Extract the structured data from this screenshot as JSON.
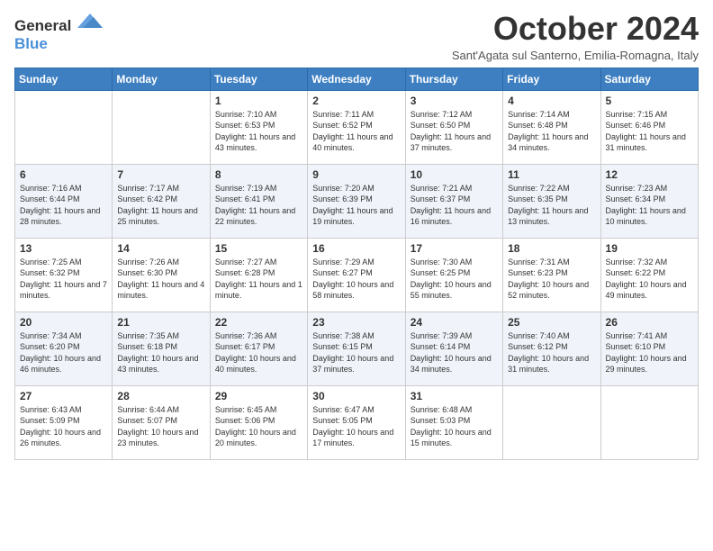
{
  "logo": {
    "general": "General",
    "blue": "Blue"
  },
  "header": {
    "month": "October 2024",
    "subtitle": "Sant'Agata sul Santerno, Emilia-Romagna, Italy"
  },
  "days_of_week": [
    "Sunday",
    "Monday",
    "Tuesday",
    "Wednesday",
    "Thursday",
    "Friday",
    "Saturday"
  ],
  "weeks": [
    [
      {
        "day": "",
        "sunrise": "",
        "sunset": "",
        "daylight": ""
      },
      {
        "day": "",
        "sunrise": "",
        "sunset": "",
        "daylight": ""
      },
      {
        "day": "1",
        "sunrise": "Sunrise: 7:10 AM",
        "sunset": "Sunset: 6:53 PM",
        "daylight": "Daylight: 11 hours and 43 minutes."
      },
      {
        "day": "2",
        "sunrise": "Sunrise: 7:11 AM",
        "sunset": "Sunset: 6:52 PM",
        "daylight": "Daylight: 11 hours and 40 minutes."
      },
      {
        "day": "3",
        "sunrise": "Sunrise: 7:12 AM",
        "sunset": "Sunset: 6:50 PM",
        "daylight": "Daylight: 11 hours and 37 minutes."
      },
      {
        "day": "4",
        "sunrise": "Sunrise: 7:14 AM",
        "sunset": "Sunset: 6:48 PM",
        "daylight": "Daylight: 11 hours and 34 minutes."
      },
      {
        "day": "5",
        "sunrise": "Sunrise: 7:15 AM",
        "sunset": "Sunset: 6:46 PM",
        "daylight": "Daylight: 11 hours and 31 minutes."
      }
    ],
    [
      {
        "day": "6",
        "sunrise": "Sunrise: 7:16 AM",
        "sunset": "Sunset: 6:44 PM",
        "daylight": "Daylight: 11 hours and 28 minutes."
      },
      {
        "day": "7",
        "sunrise": "Sunrise: 7:17 AM",
        "sunset": "Sunset: 6:42 PM",
        "daylight": "Daylight: 11 hours and 25 minutes."
      },
      {
        "day": "8",
        "sunrise": "Sunrise: 7:19 AM",
        "sunset": "Sunset: 6:41 PM",
        "daylight": "Daylight: 11 hours and 22 minutes."
      },
      {
        "day": "9",
        "sunrise": "Sunrise: 7:20 AM",
        "sunset": "Sunset: 6:39 PM",
        "daylight": "Daylight: 11 hours and 19 minutes."
      },
      {
        "day": "10",
        "sunrise": "Sunrise: 7:21 AM",
        "sunset": "Sunset: 6:37 PM",
        "daylight": "Daylight: 11 hours and 16 minutes."
      },
      {
        "day": "11",
        "sunrise": "Sunrise: 7:22 AM",
        "sunset": "Sunset: 6:35 PM",
        "daylight": "Daylight: 11 hours and 13 minutes."
      },
      {
        "day": "12",
        "sunrise": "Sunrise: 7:23 AM",
        "sunset": "Sunset: 6:34 PM",
        "daylight": "Daylight: 11 hours and 10 minutes."
      }
    ],
    [
      {
        "day": "13",
        "sunrise": "Sunrise: 7:25 AM",
        "sunset": "Sunset: 6:32 PM",
        "daylight": "Daylight: 11 hours and 7 minutes."
      },
      {
        "day": "14",
        "sunrise": "Sunrise: 7:26 AM",
        "sunset": "Sunset: 6:30 PM",
        "daylight": "Daylight: 11 hours and 4 minutes."
      },
      {
        "day": "15",
        "sunrise": "Sunrise: 7:27 AM",
        "sunset": "Sunset: 6:28 PM",
        "daylight": "Daylight: 11 hours and 1 minute."
      },
      {
        "day": "16",
        "sunrise": "Sunrise: 7:29 AM",
        "sunset": "Sunset: 6:27 PM",
        "daylight": "Daylight: 10 hours and 58 minutes."
      },
      {
        "day": "17",
        "sunrise": "Sunrise: 7:30 AM",
        "sunset": "Sunset: 6:25 PM",
        "daylight": "Daylight: 10 hours and 55 minutes."
      },
      {
        "day": "18",
        "sunrise": "Sunrise: 7:31 AM",
        "sunset": "Sunset: 6:23 PM",
        "daylight": "Daylight: 10 hours and 52 minutes."
      },
      {
        "day": "19",
        "sunrise": "Sunrise: 7:32 AM",
        "sunset": "Sunset: 6:22 PM",
        "daylight": "Daylight: 10 hours and 49 minutes."
      }
    ],
    [
      {
        "day": "20",
        "sunrise": "Sunrise: 7:34 AM",
        "sunset": "Sunset: 6:20 PM",
        "daylight": "Daylight: 10 hours and 46 minutes."
      },
      {
        "day": "21",
        "sunrise": "Sunrise: 7:35 AM",
        "sunset": "Sunset: 6:18 PM",
        "daylight": "Daylight: 10 hours and 43 minutes."
      },
      {
        "day": "22",
        "sunrise": "Sunrise: 7:36 AM",
        "sunset": "Sunset: 6:17 PM",
        "daylight": "Daylight: 10 hours and 40 minutes."
      },
      {
        "day": "23",
        "sunrise": "Sunrise: 7:38 AM",
        "sunset": "Sunset: 6:15 PM",
        "daylight": "Daylight: 10 hours and 37 minutes."
      },
      {
        "day": "24",
        "sunrise": "Sunrise: 7:39 AM",
        "sunset": "Sunset: 6:14 PM",
        "daylight": "Daylight: 10 hours and 34 minutes."
      },
      {
        "day": "25",
        "sunrise": "Sunrise: 7:40 AM",
        "sunset": "Sunset: 6:12 PM",
        "daylight": "Daylight: 10 hours and 31 minutes."
      },
      {
        "day": "26",
        "sunrise": "Sunrise: 7:41 AM",
        "sunset": "Sunset: 6:10 PM",
        "daylight": "Daylight: 10 hours and 29 minutes."
      }
    ],
    [
      {
        "day": "27",
        "sunrise": "Sunrise: 6:43 AM",
        "sunset": "Sunset: 5:09 PM",
        "daylight": "Daylight: 10 hours and 26 minutes."
      },
      {
        "day": "28",
        "sunrise": "Sunrise: 6:44 AM",
        "sunset": "Sunset: 5:07 PM",
        "daylight": "Daylight: 10 hours and 23 minutes."
      },
      {
        "day": "29",
        "sunrise": "Sunrise: 6:45 AM",
        "sunset": "Sunset: 5:06 PM",
        "daylight": "Daylight: 10 hours and 20 minutes."
      },
      {
        "day": "30",
        "sunrise": "Sunrise: 6:47 AM",
        "sunset": "Sunset: 5:05 PM",
        "daylight": "Daylight: 10 hours and 17 minutes."
      },
      {
        "day": "31",
        "sunrise": "Sunrise: 6:48 AM",
        "sunset": "Sunset: 5:03 PM",
        "daylight": "Daylight: 10 hours and 15 minutes."
      },
      {
        "day": "",
        "sunrise": "",
        "sunset": "",
        "daylight": ""
      },
      {
        "day": "",
        "sunrise": "",
        "sunset": "",
        "daylight": ""
      }
    ]
  ]
}
